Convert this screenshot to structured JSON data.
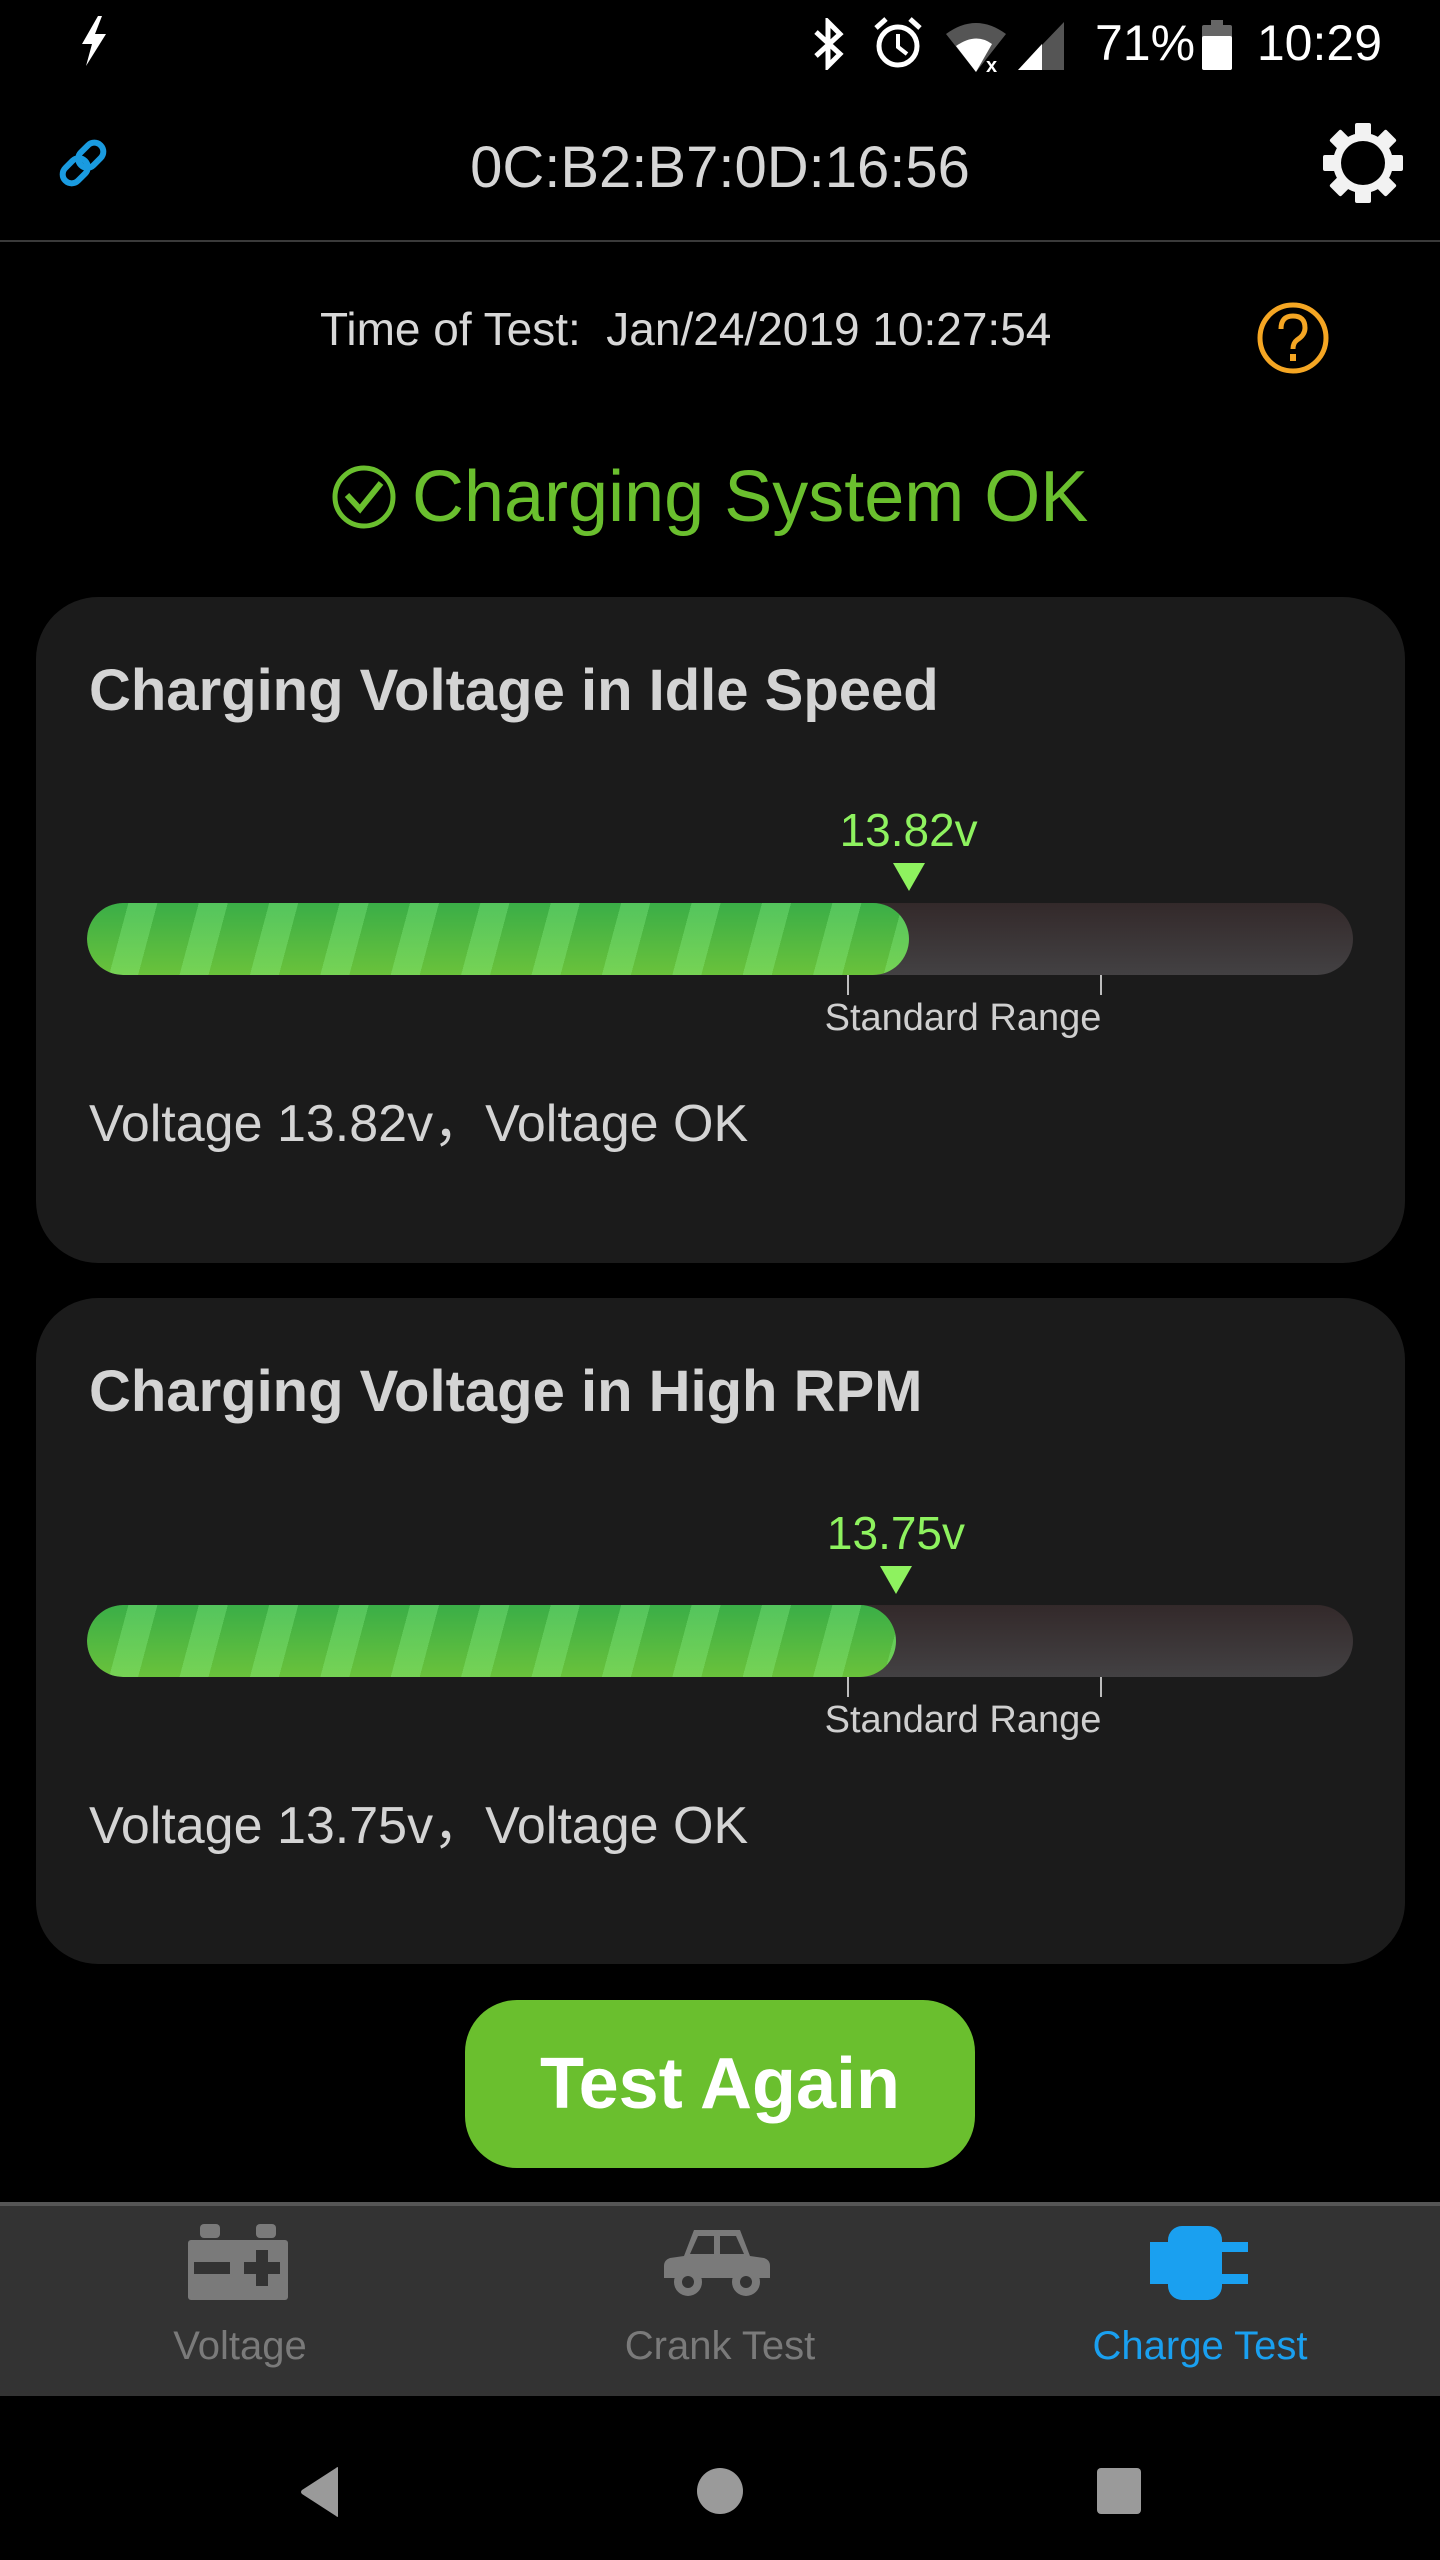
{
  "status_bar": {
    "left_icons": [
      "charging-bolt-icon"
    ],
    "right_icons": [
      "bluetooth-icon",
      "alarm-icon",
      "wifi-no-internet-icon",
      "cell-signal-icon",
      "battery-icon"
    ],
    "battery_percent": "71%",
    "time": "10:29"
  },
  "app_bar": {
    "left_icon": "link-icon",
    "title": "0C:B2:B7:0D:16:56",
    "right_icon": "settings-gear-icon"
  },
  "test_time": {
    "label": "Time of Test:  Jan/24/2019 10:27:54",
    "help_icon": "help-circle-icon"
  },
  "status": {
    "icon": "check-circle-icon",
    "text": "Charging System OK",
    "color": "#6abf2e"
  },
  "cards": [
    {
      "title": "Charging Voltage in Idle Speed",
      "reading_label": "13.82v",
      "voltage": 13.82,
      "fill_fraction": 0.649,
      "standard_range_fraction": [
        0.6,
        0.8
      ],
      "range_label": "Standard Range",
      "result": "Voltage 13.82v，Voltage OK"
    },
    {
      "title": "Charging Voltage in High RPM",
      "reading_label": "13.75v",
      "voltage": 13.75,
      "fill_fraction": 0.639,
      "standard_range_fraction": [
        0.6,
        0.8
      ],
      "range_label": "Standard Range",
      "result": "Voltage 13.75v，Voltage OK"
    }
  ],
  "actions": {
    "test_again": "Test Again"
  },
  "bottom_nav": {
    "items": [
      {
        "label": "Voltage",
        "icon": "battery-terminal-icon",
        "active": false
      },
      {
        "label": "Crank Test",
        "icon": "car-icon",
        "active": false
      },
      {
        "label": "Charge Test",
        "icon": "plug-icon",
        "active": true
      }
    ],
    "active_color": "#1aa0f0",
    "inactive_color": "#7a7a7a"
  },
  "system_nav": {
    "buttons": [
      "back-icon",
      "home-icon",
      "recents-icon"
    ]
  }
}
